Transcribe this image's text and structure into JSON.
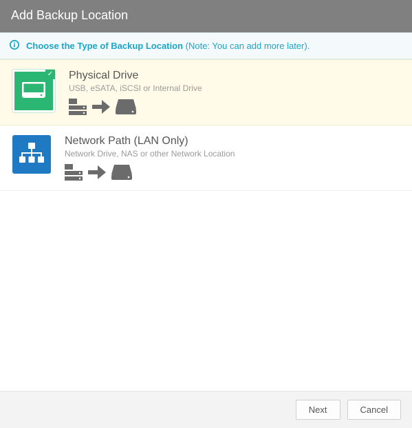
{
  "title": "Add Backup Location",
  "info": {
    "main": "Choose the Type of Backup Location",
    "note": "(Note: You can add more later)."
  },
  "options": [
    {
      "id": "physical",
      "title": "Physical Drive",
      "subtitle": "USB, eSATA, iSCSI or Internal Drive",
      "selected": true
    },
    {
      "id": "network",
      "title": "Network Path (LAN Only)",
      "subtitle": "Network Drive, NAS or other Network Location",
      "selected": false
    }
  ],
  "buttons": {
    "next": "Next",
    "cancel": "Cancel"
  }
}
